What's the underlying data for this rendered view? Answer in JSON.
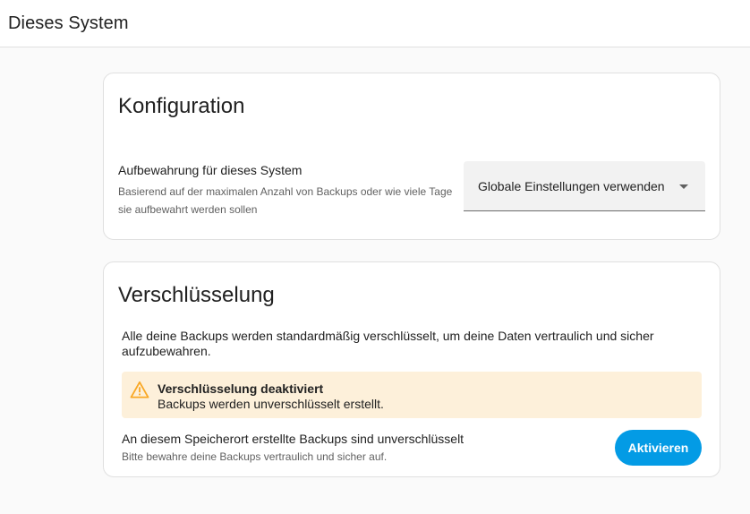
{
  "header": {
    "title": "Dieses System"
  },
  "configuration": {
    "title": "Konfiguration",
    "retention": {
      "label": "Aufbewahrung für dieses System",
      "description": "Basierend auf der maximalen Anzahl von Backups oder wie viele Tage sie aufbewahrt werden sollen",
      "selected_value": "Globale Einstellungen verwenden"
    }
  },
  "encryption": {
    "title": "Verschlüsselung",
    "description": "Alle deine Backups werden standardmäßig verschlüsselt, um deine Daten vertraulich und sicher aufzubewahren.",
    "alert": {
      "icon": "warning-icon",
      "title": "Verschlüsselung deaktiviert",
      "text": "Backups werden unverschlüsselt erstellt."
    },
    "location": {
      "label": "An diesem Speicherort erstellte Backups sind unverschlüsselt",
      "hint": "Bitte bewahre deine Backups vertraulich und sicher auf."
    },
    "activate_label": "Aktivieren"
  },
  "colors": {
    "accent": "#039be5",
    "warning_bg": "#fdf0da",
    "warning_icon": "#f9a825"
  }
}
